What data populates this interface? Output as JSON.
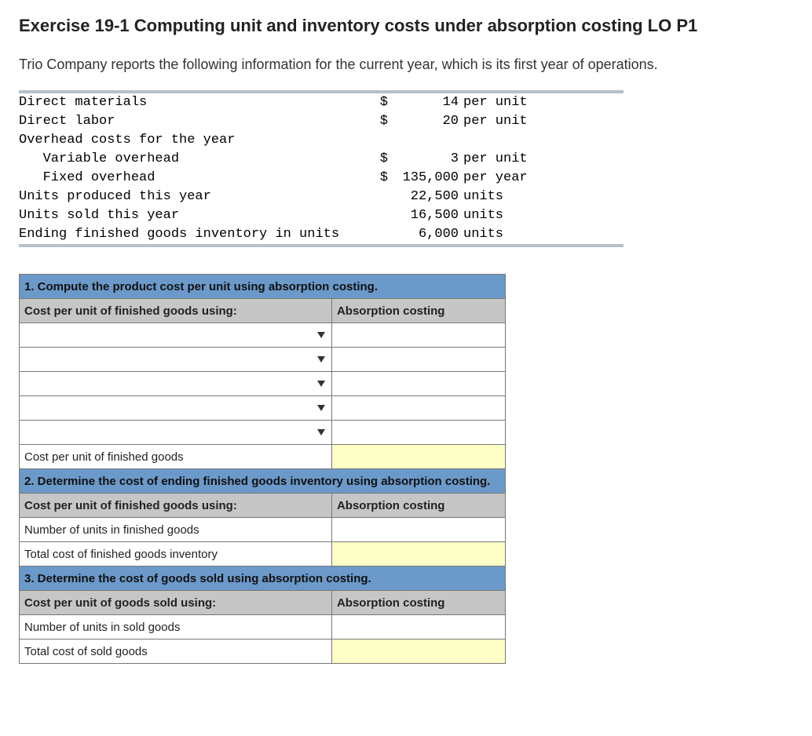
{
  "title": "Exercise 19-1 Computing unit and inventory costs under absorption costing LO P1",
  "intro": "Trio Company reports the following information for the current year, which is its first year of operations.",
  "facts": {
    "direct_materials": {
      "label": "Direct materials",
      "currency": "$",
      "value": "14",
      "unit": "per unit"
    },
    "direct_labor": {
      "label": "Direct labor",
      "currency": "$",
      "value": "20",
      "unit": "per unit"
    },
    "overhead_header": "Overhead costs for the year",
    "variable_overhead": {
      "label": "   Variable overhead",
      "currency": "$",
      "value": "3",
      "unit": "per unit"
    },
    "fixed_overhead": {
      "label": "   Fixed overhead",
      "currency": "$",
      "value": "135,000",
      "unit": "per year"
    },
    "units_produced": {
      "label": "Units produced this year",
      "value": "22,500",
      "unit": "units"
    },
    "units_sold": {
      "label": "Units sold this year",
      "value": "16,500",
      "unit": "units"
    },
    "ending_inventory": {
      "label": "Ending finished goods inventory in units",
      "value": "6,000",
      "unit": "units"
    }
  },
  "worksheet": {
    "q1_head": "1. Compute the product cost per unit using absorption costing.",
    "q1_subhead_left": "Cost per unit of finished goods using:",
    "q1_subhead_right": "Absorption costing",
    "q1_total_row": "Cost per unit of finished goods",
    "q2_head": "2. Determine the cost of ending finished goods inventory using absorption costing.",
    "q2_subhead_left": "Cost per unit of finished goods using:",
    "q2_subhead_right": "Absorption costing",
    "q2_row1": "Number of units in finished goods",
    "q2_row2": "Total cost of finished goods inventory",
    "q3_head": "3. Determine the cost of goods sold using absorption costing.",
    "q3_subhead_left": "Cost per unit of goods sold using:",
    "q3_subhead_right": "Absorption costing",
    "q3_row1": "Number of units in sold goods",
    "q3_row2": "Total cost of sold goods"
  }
}
